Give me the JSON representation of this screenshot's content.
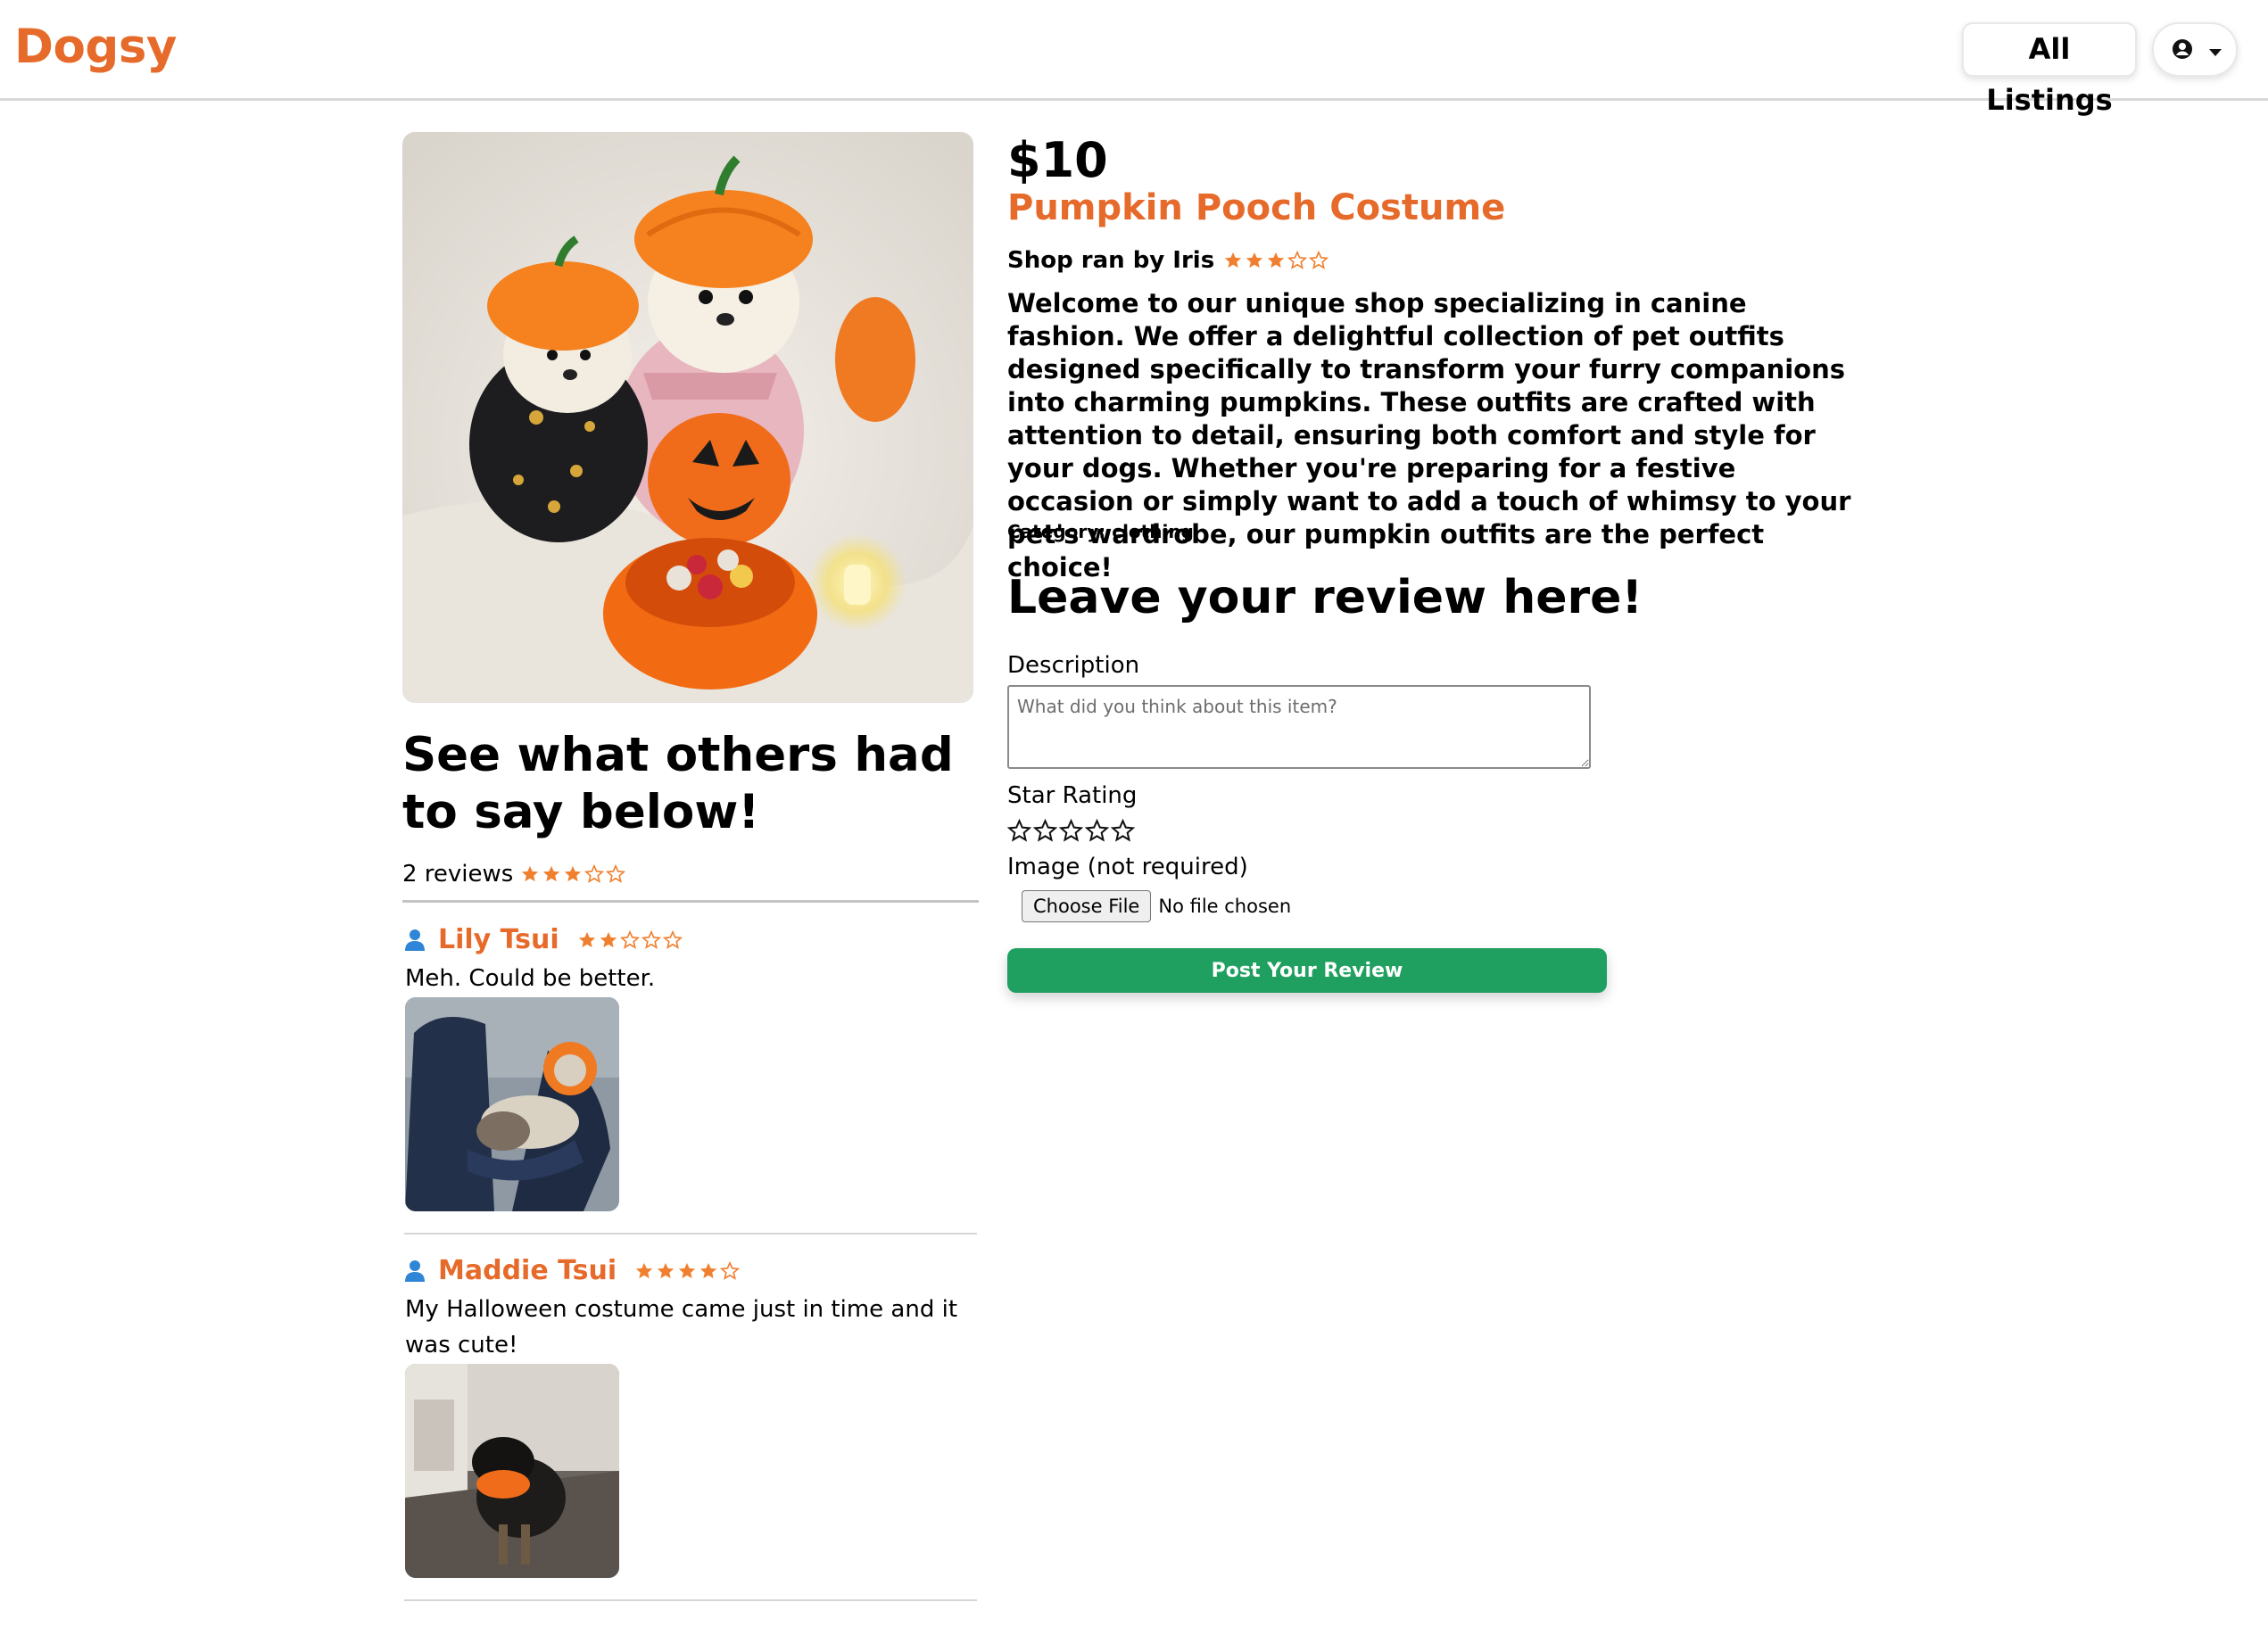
{
  "app": {
    "logo": "Dogsy"
  },
  "header": {
    "all_listings_label": "All Listings"
  },
  "listing": {
    "price": "$10",
    "title": "Pumpkin Pooch Costume",
    "shop_label": "Shop ran by Iris",
    "shop_rating": 3,
    "description": "Welcome to our unique shop specializing in canine fashion. We offer a delightful collection of pet outfits designed specifically to transform your furry companions into charming pumpkins. These outfits are crafted with attention to detail, ensuring both comfort and style for your dogs. Whether you're preparing for a festive occasion or simply want to add a touch of whimsy to your pet's wardrobe, our pumpkin outfits are the perfect choice!",
    "category": "Category: clothing"
  },
  "reviews_section": {
    "title": "See what others had to say below!",
    "count_label": "2 reviews",
    "average_rating": 3,
    "items": [
      {
        "name": "Lily Tsui",
        "rating": 2,
        "text": "Meh. Could be better."
      },
      {
        "name": "Maddie Tsui",
        "rating": 4,
        "text": "My Halloween costume came just in time and it was cute!"
      }
    ]
  },
  "review_form": {
    "title": "Leave your review here!",
    "description_label": "Description",
    "description_placeholder": "What did you think about this item?",
    "star_label": "Star Rating",
    "star_value": 0,
    "image_label": "Image (not required)",
    "choose_file_label": "Choose File",
    "no_file_label": "No file chosen",
    "submit_label": "Post Your Review"
  },
  "colors": {
    "brand": "#e66a2a",
    "star": "#f0802f",
    "submit": "#20a060",
    "user_icon": "#2f86d6"
  }
}
